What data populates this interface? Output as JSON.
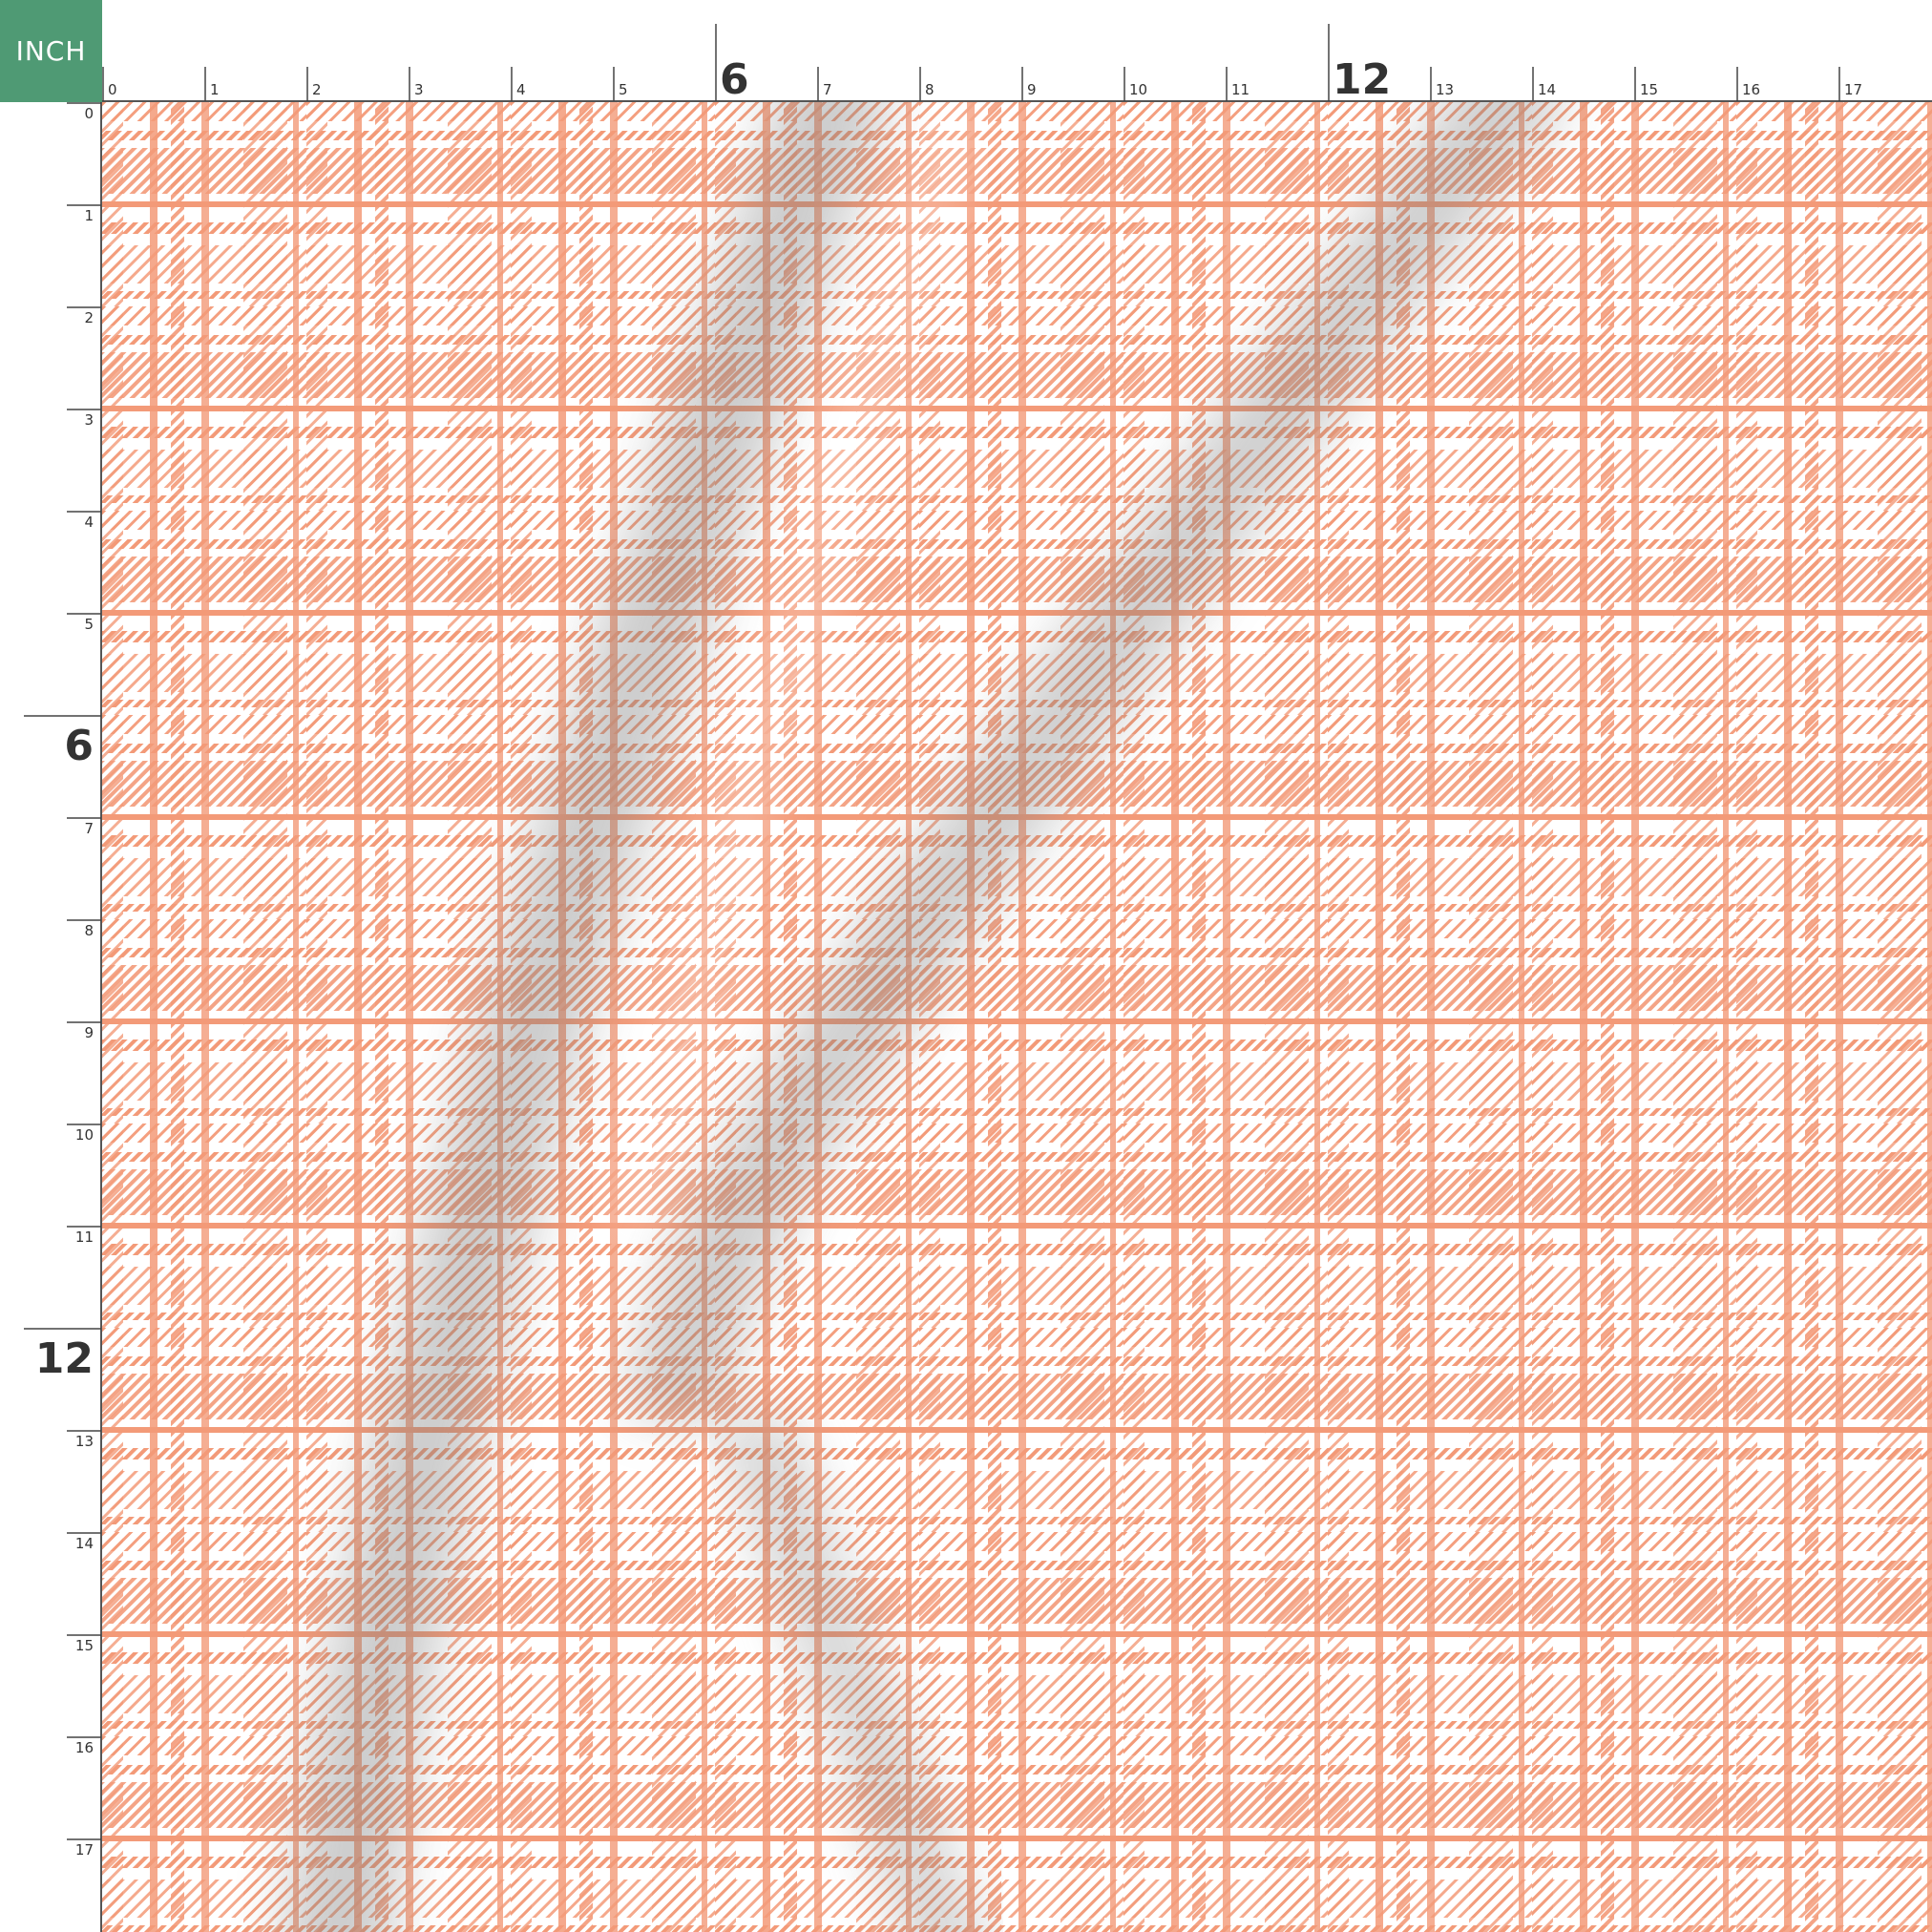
{
  "unit_badge": {
    "label": "INCH",
    "color": "#4f9a74"
  },
  "ruler": {
    "top_labels": [
      "0",
      "1",
      "2",
      "3",
      "4",
      "5",
      "6",
      "7",
      "8",
      "9",
      "10",
      "11",
      "12",
      "13",
      "14",
      "15",
      "16",
      "17"
    ],
    "left_labels": [
      "0",
      "1",
      "2",
      "3",
      "4",
      "5",
      "6",
      "7",
      "8",
      "9",
      "10",
      "11",
      "12",
      "13",
      "14",
      "15",
      "16",
      "17"
    ],
    "major_labels": [
      "6",
      "12"
    ]
  },
  "fabric": {
    "pattern": "plaid",
    "colors": {
      "stripe": "#f39a78",
      "base": "#ffffff",
      "shadow": "#7a7a7a"
    }
  }
}
